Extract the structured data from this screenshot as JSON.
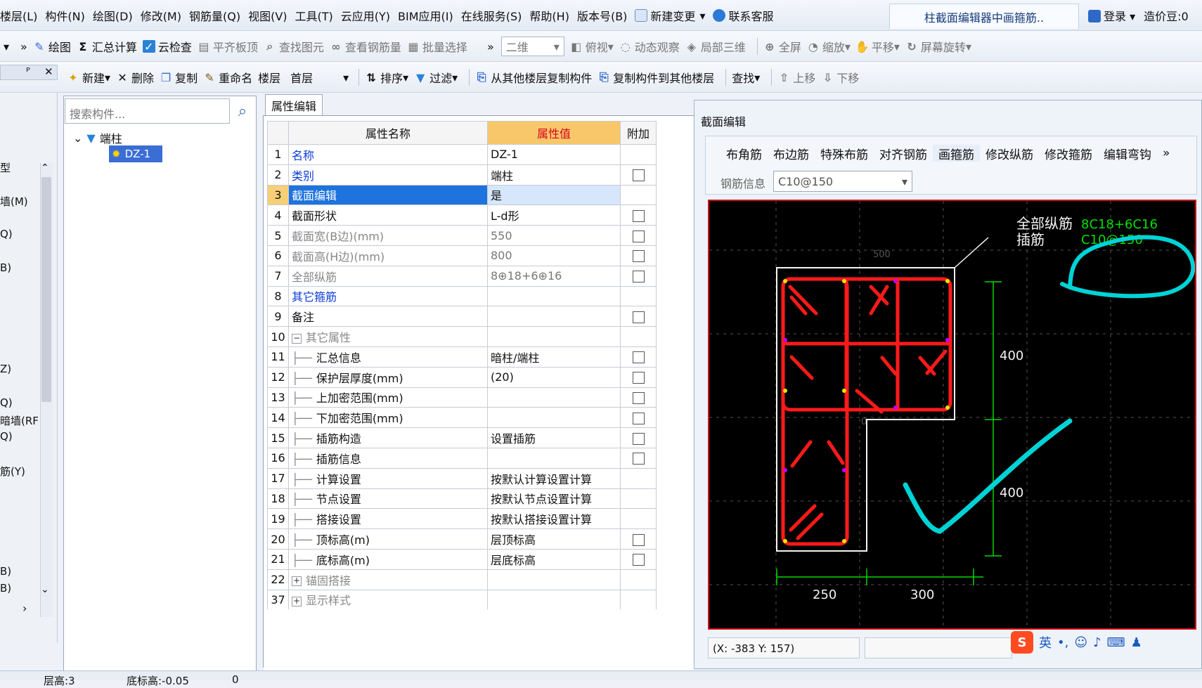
{
  "menu": {
    "items": [
      "楼层(L)",
      "构件(N)",
      "绘图(D)",
      "修改(M)",
      "钢筋量(Q)",
      "视图(V)",
      "工具(T)",
      "云应用(Y)",
      "BIM应用(I)",
      "在线服务(S)",
      "帮助(H)",
      "版本号(B)",
      "新建变更",
      "联系客服"
    ],
    "title_tab": "柱截面编辑器中画箍筋..",
    "right": [
      "登录",
      "造价豆:0"
    ]
  },
  "toolbar1": {
    "items": [
      "绘图",
      "汇总计算",
      "云检查",
      "平齐板顶",
      "查找图元",
      "查看钢筋量",
      "批量选择"
    ],
    "view_mode": "二维",
    "view_items": [
      "俯视",
      "动态观察",
      "局部三维",
      "全屏",
      "缩放",
      "平移",
      "屏幕旋转"
    ]
  },
  "toolbar2": {
    "items": [
      "新建",
      "删除",
      "复制",
      "重命名"
    ],
    "floor_label": "楼层",
    "floor_value": "首层",
    "tools": [
      "排序",
      "过滤",
      "从其他楼层复制构件",
      "复制构件到其他楼层",
      "查找",
      "上移",
      "下移"
    ]
  },
  "left_panel": {
    "head": "ᴾ",
    "items": [
      "型",
      "墙(M)",
      "Q)",
      "B)",
      "Z)",
      "Q)",
      "暗墙(RF",
      "Q)",
      "筋(Y)",
      "B)",
      "B)"
    ]
  },
  "tree": {
    "search_placeholder": "搜索构件...",
    "root": "端柱",
    "node": "DZ-1"
  },
  "property_panel": {
    "tab": "属性编辑",
    "columns": [
      "属性名称",
      "属性值",
      "附加"
    ],
    "rows": [
      {
        "num": "1",
        "name": "名称",
        "value": "DZ-1",
        "type": "blue",
        "check": false
      },
      {
        "num": "2",
        "name": "类别",
        "value": "端柱",
        "type": "blue",
        "check": true
      },
      {
        "num": "3",
        "name": "截面编辑",
        "value": "是",
        "type": "selected",
        "check": false
      },
      {
        "num": "4",
        "name": "截面形状",
        "value": "L-d形",
        "type": "black",
        "check": true
      },
      {
        "num": "5",
        "name": "截面宽(B边)(mm)",
        "value": "550",
        "type": "gray",
        "check": true
      },
      {
        "num": "6",
        "name": "截面高(H边)(mm)",
        "value": "800",
        "type": "gray",
        "check": true
      },
      {
        "num": "7",
        "name": "全部纵筋",
        "value": "8⊕18+6⊕16",
        "type": "gray",
        "check": true
      },
      {
        "num": "8",
        "name": "其它箍筋",
        "value": "",
        "type": "blue",
        "check": false
      },
      {
        "num": "9",
        "name": "备注",
        "value": "",
        "type": "black",
        "check": true
      },
      {
        "num": "10",
        "name": "其它属性",
        "value": "",
        "type": "group",
        "check": false
      },
      {
        "num": "11",
        "name": "汇总信息",
        "value": "暗柱/端柱",
        "type": "child",
        "check": true
      },
      {
        "num": "12",
        "name": "保护层厚度(mm)",
        "value": "(20)",
        "type": "child",
        "check": true
      },
      {
        "num": "13",
        "name": "上加密范围(mm)",
        "value": "",
        "type": "child",
        "check": true
      },
      {
        "num": "14",
        "name": "下加密范围(mm)",
        "value": "",
        "type": "child",
        "check": true
      },
      {
        "num": "15",
        "name": "插筋构造",
        "value": "设置插筋",
        "type": "child",
        "check": true
      },
      {
        "num": "16",
        "name": "插筋信息",
        "value": "",
        "type": "child",
        "check": true
      },
      {
        "num": "17",
        "name": "计算设置",
        "value": "按默认计算设置计算",
        "type": "child",
        "check": false
      },
      {
        "num": "18",
        "name": "节点设置",
        "value": "按默认节点设置计算",
        "type": "child",
        "check": false
      },
      {
        "num": "19",
        "name": "搭接设置",
        "value": "按默认搭接设置计算",
        "type": "child",
        "check": false
      },
      {
        "num": "20",
        "name": "顶标高(m)",
        "value": "层顶标高",
        "type": "child",
        "check": true
      },
      {
        "num": "21",
        "name": "底标高(m)",
        "value": "层底标高",
        "type": "child",
        "check": true
      },
      {
        "num": "22",
        "name": "锚固搭接",
        "value": "",
        "type": "group-plus",
        "check": false
      },
      {
        "num": "37",
        "name": "显示样式",
        "value": "",
        "type": "group-plus",
        "check": false
      }
    ]
  },
  "section_editor": {
    "title": "截面编辑",
    "tabs": [
      "布角筋",
      "布边筋",
      "特殊布筋",
      "对齐钢筋",
      "画箍筋",
      "修改纵筋",
      "修改箍筋",
      "编辑弯钩"
    ],
    "rebar_info_label": "钢筋信息",
    "rebar_info_value": "C10@150",
    "annotation_main": "全部纵筋",
    "annotation_main_value": "8C18+6C16",
    "annotation_tie": "插筋",
    "annotation_tie_value": "C10@150",
    "dim_top": "400",
    "dim_bottom": "400",
    "dim_left": "250",
    "dim_right": "300",
    "axis_label_top": "500",
    "axis_label_mid": "0",
    "coord": "(X: -383 Y: 157)"
  },
  "status": {
    "items": [
      "层高:3",
      "底标高:-0.05",
      "0"
    ]
  },
  "ime": {
    "lang": "英"
  }
}
